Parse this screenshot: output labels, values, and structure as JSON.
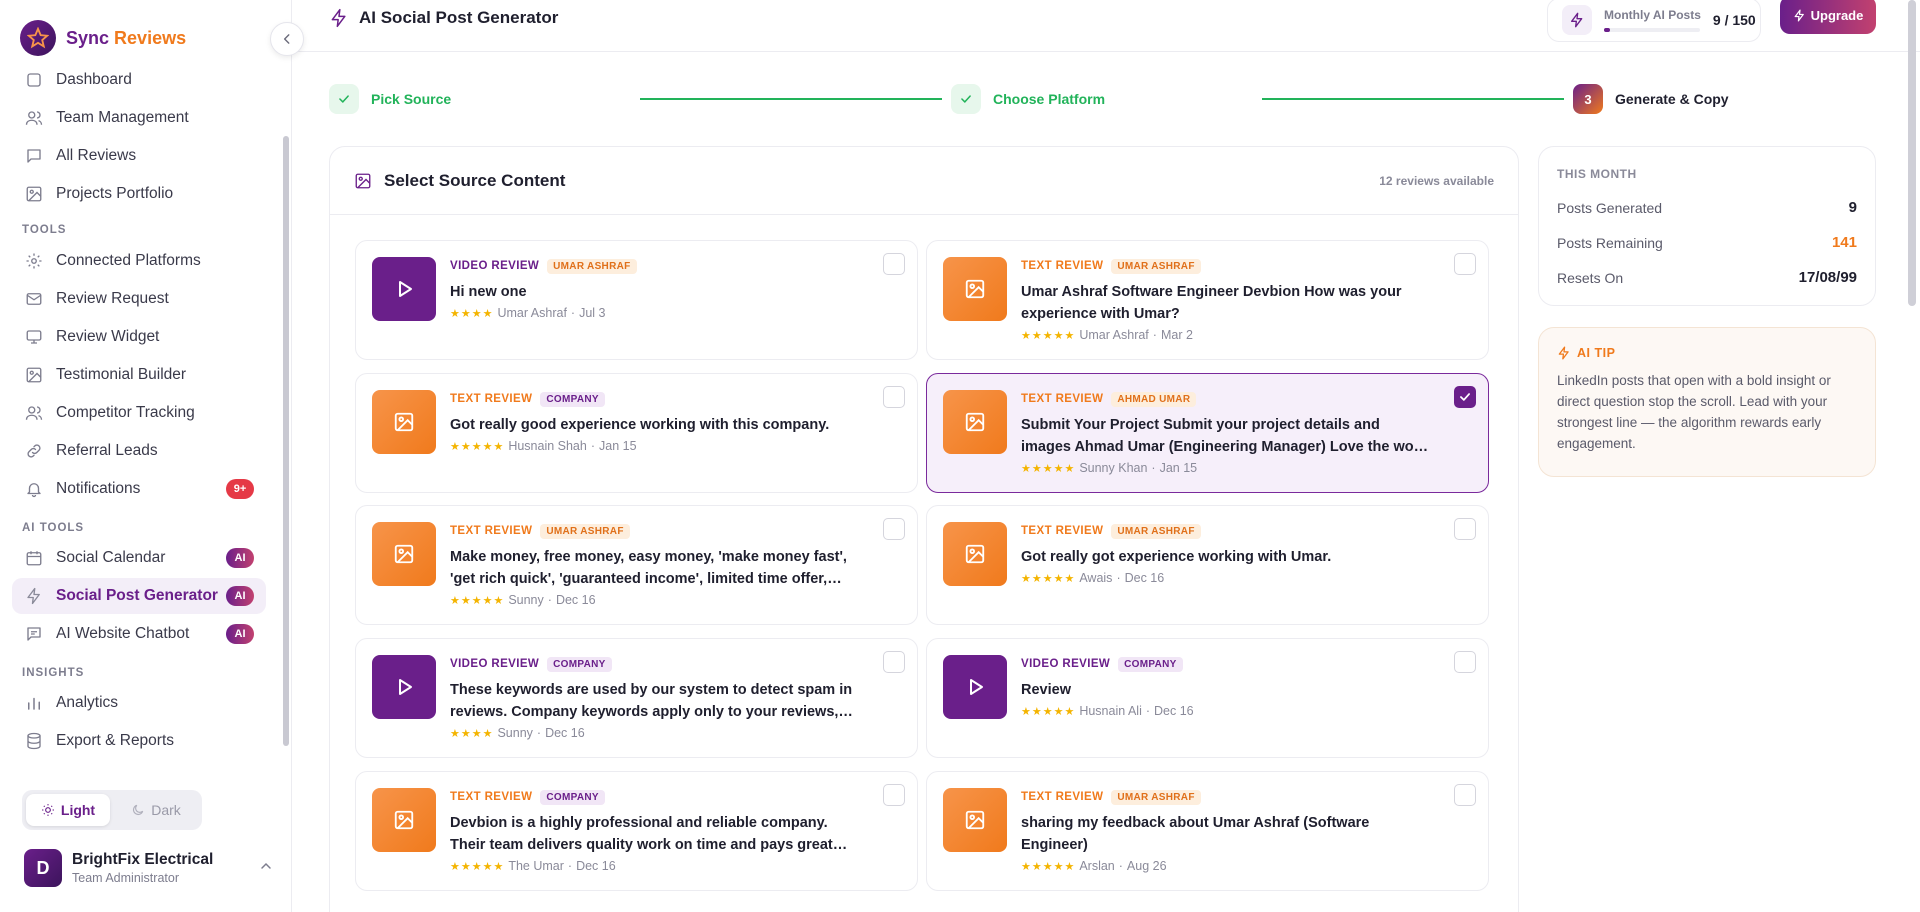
{
  "brand": {
    "name_primary": "Sync",
    "name_accent": "Reviews"
  },
  "sidebar": {
    "items_top": [
      {
        "label": "Dashboard",
        "icon": "dashboard-icon"
      },
      {
        "label": "Team Management",
        "icon": "users-icon"
      },
      {
        "label": "All Reviews",
        "icon": "message-icon"
      },
      {
        "label": "Projects Portfolio",
        "icon": "image-icon"
      }
    ],
    "section_tools": "TOOLS",
    "items_tools": [
      {
        "label": "Connected Platforms",
        "icon": "gear-icon"
      },
      {
        "label": "Review Request",
        "icon": "mail-icon"
      },
      {
        "label": "Review Widget",
        "icon": "monitor-icon"
      },
      {
        "label": "Testimonial Builder",
        "icon": "image-icon"
      },
      {
        "label": "Competitor Tracking",
        "icon": "users-icon"
      },
      {
        "label": "Referral Leads",
        "icon": "link-icon"
      },
      {
        "label": "Notifications",
        "icon": "bell-icon",
        "badge": "9+"
      }
    ],
    "section_ai": "AI TOOLS",
    "items_ai": [
      {
        "label": "Social Calendar",
        "icon": "calendar-icon",
        "badge": "AI"
      },
      {
        "label": "Social Post Generator",
        "icon": "bolt-icon",
        "badge": "AI",
        "active": true
      },
      {
        "label": "AI Website Chatbot",
        "icon": "chat-icon",
        "badge": "AI"
      }
    ],
    "section_insights": "INSIGHTS",
    "items_insights": [
      {
        "label": "Analytics",
        "icon": "bar-chart-icon"
      },
      {
        "label": "Export & Reports",
        "icon": "database-icon"
      }
    ],
    "theme": {
      "light": "Light",
      "dark": "Dark",
      "selected": "Light"
    },
    "user": {
      "initial": "D",
      "name": "BrightFix Electrical",
      "role": "Team Administrator"
    }
  },
  "header": {
    "title": "AI Social Post Generator",
    "quota_label": "Monthly AI Posts",
    "quota_value": "9 / 150",
    "quota_fraction": 0.06,
    "upgrade_label": "Upgrade"
  },
  "stepper": {
    "steps": [
      {
        "label": "Pick Source",
        "state": "done"
      },
      {
        "label": "Choose Platform",
        "state": "done"
      },
      {
        "label": "Generate & Copy",
        "state": "current",
        "number": "3"
      }
    ]
  },
  "source": {
    "title": "Select Source Content",
    "count_label": "12 reviews available",
    "reviews": [
      {
        "type": "video",
        "type_label": "VIDEO REVIEW",
        "tag": "UMAR ASHRAF",
        "tag_color": "orange",
        "text": "Hi new one",
        "stars": "★★★★",
        "author": "Umar Ashraf",
        "date": "Jul 3",
        "selected": false
      },
      {
        "type": "text",
        "type_label": "TEXT REVIEW",
        "tag": "UMAR ASHRAF",
        "tag_color": "orange",
        "text": "Umar Ashraf Software Engineer Devbion How was your experience with Umar?",
        "stars": "★★★★★",
        "author": "Umar Ashraf",
        "date": "Mar 2",
        "selected": false
      },
      {
        "type": "text",
        "type_label": "TEXT REVIEW",
        "tag": "COMPANY",
        "tag_color": "purple",
        "text": "Got really good experience working with this company.",
        "stars": "★★★★★",
        "author": "Husnain Shah",
        "date": "Jan 15",
        "selected": false
      },
      {
        "type": "text",
        "type_label": "TEXT REVIEW",
        "tag": "AHMAD UMAR",
        "tag_color": "orange",
        "text": "Submit Your Project Submit your project details and images Ahmad Umar (Engineering Manager) Love the work, guy and company.",
        "stars": "★★★★★",
        "author": "Sunny Khan",
        "date": "Jan 15",
        "selected": true
      },
      {
        "type": "text",
        "type_label": "TEXT REVIEW",
        "tag": "UMAR ASHRAF",
        "tag_color": "orange",
        "text": "Make money, free money, easy money, 'make money fast', 'get rich quick', 'guaranteed income', limited time offer, viagra, claim your…",
        "stars": "★★★★★",
        "author": "Sunny",
        "date": "Dec 16",
        "selected": false
      },
      {
        "type": "text",
        "type_label": "TEXT REVIEW",
        "tag": "UMAR ASHRAF",
        "tag_color": "orange",
        "text": "Got really got experience working with Umar.",
        "stars": "★★★★★",
        "author": "Awais",
        "date": "Dec 16",
        "selected": false
      },
      {
        "type": "video",
        "type_label": "VIDEO REVIEW",
        "tag": "COMPANY",
        "tag_color": "purple",
        "text": "These keywords are used by our system to detect spam in reviews. Company keywords apply only to your reviews, while global…",
        "stars": "★★★★",
        "author": "Sunny",
        "date": "Dec 16",
        "selected": false
      },
      {
        "type": "video",
        "type_label": "VIDEO REVIEW",
        "tag": "COMPANY",
        "tag_color": "purple",
        "text": "Review",
        "stars": "★★★★★",
        "author": "Husnain Ali",
        "date": "Dec 16",
        "selected": false
      },
      {
        "type": "text",
        "type_label": "TEXT REVIEW",
        "tag": "COMPANY",
        "tag_color": "purple",
        "text": "Devbion is a highly professional and reliable company. Their team delivers quality work on time and pays great attention to detail. A…",
        "stars": "★★★★★",
        "author": "The Umar",
        "date": "Dec 16",
        "selected": false
      },
      {
        "type": "text",
        "type_label": "TEXT REVIEW",
        "tag": "UMAR ASHRAF",
        "tag_color": "orange",
        "text": "sharing my feedback about Umar Ashraf (Software Engineer)",
        "stars": "★★★★★",
        "author": "Arslan",
        "date": "Aug 26",
        "selected": false
      }
    ]
  },
  "stats": {
    "title": "THIS MONTH",
    "rows": [
      {
        "label": "Posts Generated",
        "value": "9",
        "color": "dark"
      },
      {
        "label": "Posts Remaining",
        "value": "141",
        "color": "orange"
      },
      {
        "label": "Resets On",
        "value": "17/08/99",
        "color": "dark"
      }
    ]
  },
  "tip": {
    "title": "AI TIP",
    "text": "LinkedIn posts that open with a bold insight or direct question stop the scroll. Lead with your strongest line — the algorithm rewards early engagement."
  },
  "colors": {
    "brand_purple": "#6a1f8a",
    "brand_orange": "#f07a1c",
    "success_green": "#22b35a",
    "badge_red": "#e53946"
  }
}
